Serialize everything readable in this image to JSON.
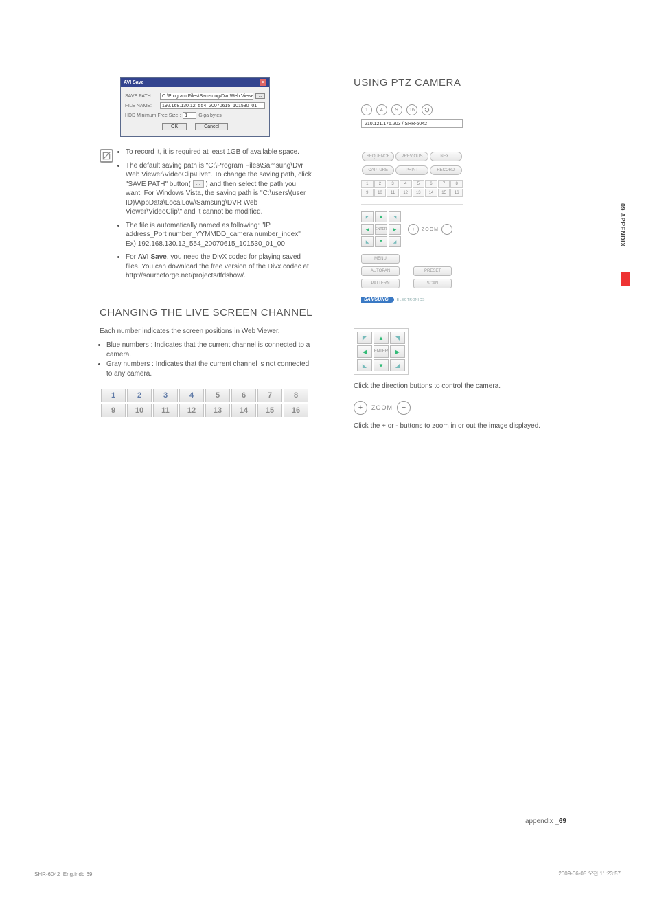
{
  "side_tab": "09 APPENDIX",
  "avi_dialog": {
    "title": "AVI Save",
    "save_path_label": "SAVE PATH:",
    "save_path_value": "C:\\Program Files\\Samsung\\Dvr Web Viewer\\Vi",
    "browse": "...",
    "file_name_label": "FILE NAME:",
    "file_name_value": "192.168.130.12_554_20070615_101530_01_",
    "hdd_label": "HDD Minimum Free Size :",
    "hdd_value": "1",
    "hdd_unit": "Giga bytes",
    "ok": "OK",
    "cancel": "Cancel"
  },
  "note": {
    "b1": "To record it, it is required at least 1GB of available space.",
    "b2a": "The default saving path is \"C:\\Program Files\\Samsung\\Dvr Web Viewer\\VideoClip\\Live\". To change the saving path, click \"SAVE PATH\" button(",
    "b2_btn": "...",
    "b2b": ") and then select the path you want. For Windows Vista, the saving path is \"C:\\users\\(user ID)\\AppData\\LocalLow\\Samsung\\DVR Web Viewer\\VideoClip\\\" and it cannot be modified.",
    "b3": "The file is automatically named as following: \"IP address_Port number_YYMMDD_camera number_index\" Ex) 192.168.130.12_554_20070615_101530_01_00",
    "b4a": "For ",
    "b4_bold": "AVI Save",
    "b4b": ", you need the DivX codec for playing saved files. You can download the free version of the Divx codec at http://sourceforge.net/projects/ffdshow/."
  },
  "section_changing": {
    "heading": "CHANGING THE LIVE SCREEN CHANNEL",
    "intro": "Each number indicates the screen positions in Web Viewer.",
    "blue": "Blue numbers : Indicates that the current channel is connected to a camera.",
    "gray": "Gray numbers : Indicates that the current channel is not connected to any camera.",
    "cells": [
      "1",
      "2",
      "3",
      "4",
      "5",
      "6",
      "7",
      "8",
      "9",
      "10",
      "11",
      "12",
      "13",
      "14",
      "15",
      "16"
    ]
  },
  "section_ptz": {
    "heading": "USING PTZ CAMERA",
    "layouts": [
      "1",
      "4",
      "9",
      "16"
    ],
    "address": "210.121.176.203 / SHR-6042",
    "row1": [
      "SEQUENCE",
      "PREVIOUS",
      "NEXT"
    ],
    "row2": [
      "CAPTURE",
      "PRINT",
      "RECORD"
    ],
    "nums": [
      "1",
      "2",
      "3",
      "4",
      "5",
      "6",
      "7",
      "8",
      "9",
      "10",
      "11",
      "12",
      "13",
      "14",
      "15",
      "16"
    ],
    "enter": "ENTER",
    "zoom": "ZOOM",
    "menu": "MENU",
    "autopan": "AUTOPAN",
    "preset": "PRESET",
    "pattern": "PATTERN",
    "scan": "SCAN",
    "brand": "SAMSUNG",
    "brand_sub": "ELECTRONICS",
    "dir_desc": "Click the direction buttons to control the camera.",
    "zoom_desc": "Click the + or - buttons to zoom in or out the image displayed."
  },
  "footer": {
    "label": "appendix _",
    "page": "69"
  },
  "print": {
    "left": "SHR-6042_Eng.indb   69",
    "right": "2009-06-05   오전 11:23:57"
  }
}
